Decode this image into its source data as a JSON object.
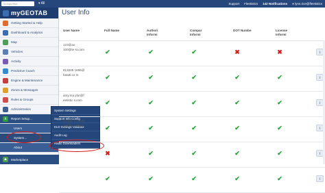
{
  "topbar": {
    "search_placeholder": "Groups filter",
    "filter_value": "All",
    "links": [
      "Support",
      "Fleetistics",
      "142 Notifications"
    ],
    "user": "lynn.rice@fleetistics"
  },
  "app": {
    "logo_text": "myGEOTAB"
  },
  "sidebar": {
    "items": [
      {
        "label": "Getting Started & Help",
        "color": "#e06b2c"
      },
      {
        "label": "Dashboard & Analytics",
        "color": "#3b6db3"
      },
      {
        "label": "Map",
        "color": "#4d9f57"
      },
      {
        "label": "Vehicles",
        "color": "#5b7fb5"
      },
      {
        "label": "Activity",
        "color": "#7a5ab5"
      },
      {
        "label": "Predictive Coach",
        "color": "#2e8ecf"
      },
      {
        "label": "Engine & Maintenance",
        "color": "#c43f3f"
      },
      {
        "label": "Zones & Messages",
        "color": "#e0a02c"
      },
      {
        "label": "Rules & Groups",
        "color": "#d24b4b"
      },
      {
        "label": "Administration",
        "color": "#3e5f8f"
      }
    ],
    "report_setup": "Report Setup...",
    "sub_items": [
      "Users",
      "System...",
      "About"
    ],
    "marketplace": "Marketplace"
  },
  "submenu": {
    "items": [
      "System Settings",
      "Support Info Config",
      "ELD Settings Validator",
      "Audit Log",
      "Radio Downloaders"
    ]
  },
  "main": {
    "title": "User Info",
    "columns": [
      "User Name",
      "Full Name",
      "Authori Informi",
      "Compar Informi",
      "DOT Numbe",
      "License Informi"
    ],
    "rows": [
      {
        "user": "123@ax 100@te st.com",
        "marks": [
          "ok",
          "ok",
          "ok",
          "no",
          "no"
        ]
      },
      {
        "user": "813205 1655@ fatatti.co m",
        "marks": [
          "ok",
          "ok",
          "ok",
          "ok",
          "ok"
        ]
      },
      {
        "user": "amy.ma ylor@f eetistic s.com",
        "marks": [
          "ok",
          "ok",
          "ok",
          "ok",
          "ok"
        ]
      },
      {
        "user": "brando n.santie go@fle etistics.",
        "marks": [
          "ok",
          "ok",
          "ok",
          "ok",
          "ok"
        ]
      },
      {
        "user": "",
        "marks": [
          "no",
          "ok",
          "ok",
          "ok",
          "ok"
        ]
      },
      {
        "user": "",
        "marks": [
          "ok",
          "ok",
          "ok",
          "ok",
          "ok"
        ]
      }
    ],
    "info_icon": "i"
  },
  "colors": {
    "topbar": "#25477b",
    "ok": "#27a33a",
    "no": "#d51f1f",
    "highlight": "#d81b1b"
  }
}
